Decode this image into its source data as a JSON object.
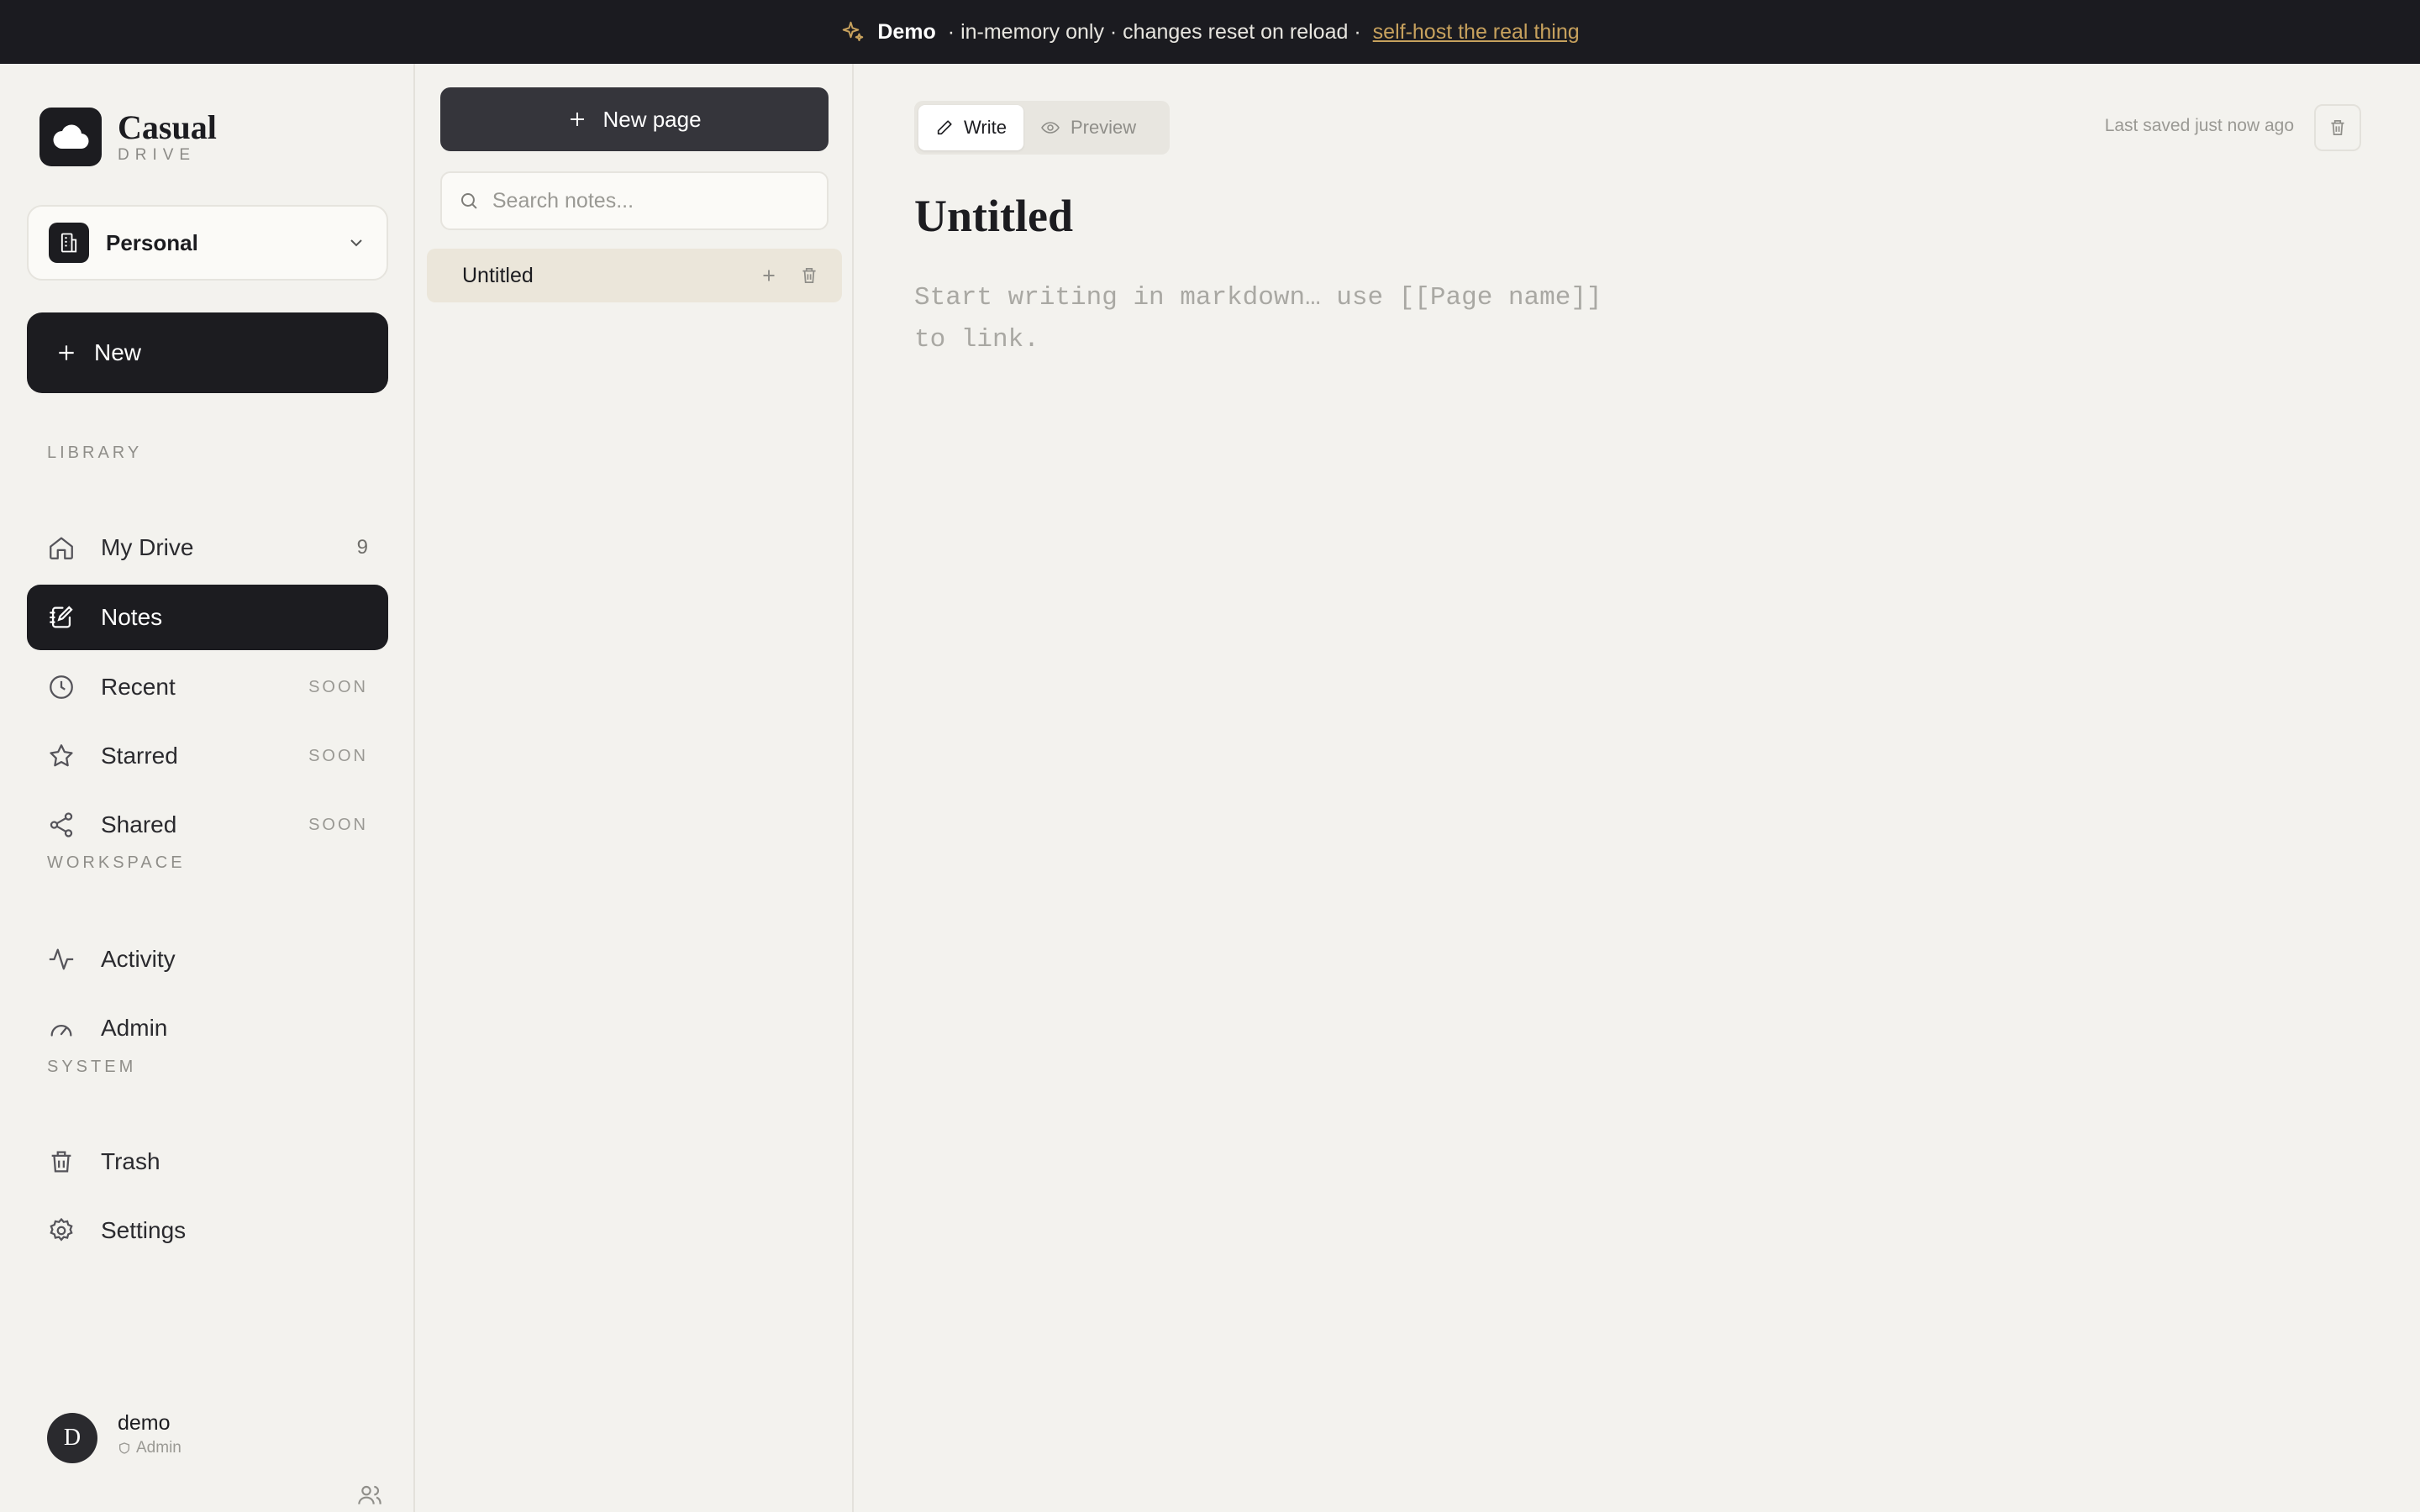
{
  "banner": {
    "strong": "Demo",
    "text": "· in-memory only · changes reset on reload ·",
    "link": "self-host the real thing",
    "accent": "#c7a15d"
  },
  "brand": {
    "name": "Casual",
    "sub": "DRIVE"
  },
  "workspace": {
    "label": "Personal",
    "icon": "building-icon"
  },
  "sidebar": {
    "new_label": "New",
    "sections": {
      "library": "LIBRARY",
      "workspace": "WORKSPACE",
      "system": "SYSTEM"
    },
    "items": [
      {
        "label": "My Drive",
        "icon": "home-icon",
        "meta": "9"
      },
      {
        "label": "Notes",
        "icon": "notes-icon",
        "meta": "",
        "active": true
      },
      {
        "label": "Recent",
        "icon": "clock-icon",
        "meta": "SOON"
      },
      {
        "label": "Starred",
        "icon": "star-icon",
        "meta": "SOON"
      },
      {
        "label": "Shared",
        "icon": "share-icon",
        "meta": "SOON"
      },
      {
        "label": "Activity",
        "icon": "activity-icon",
        "meta": ""
      },
      {
        "label": "Admin",
        "icon": "gauge-icon",
        "meta": ""
      },
      {
        "label": "Trash",
        "icon": "trash-icon",
        "meta": ""
      },
      {
        "label": "Settings",
        "icon": "gear-icon",
        "meta": ""
      }
    ]
  },
  "user": {
    "initial": "D",
    "name": "demo",
    "role": "Admin"
  },
  "notes": {
    "new_page_label": "New page",
    "search_placeholder": "Search notes...",
    "items": [
      {
        "title": "Untitled"
      }
    ]
  },
  "editor": {
    "tab_write": "Write",
    "tab_preview": "Preview",
    "active_tab": "Write",
    "saved": "Last saved just now ago",
    "title": "Untitled",
    "body_placeholder": "Start writing in markdown… use [[Page name]]\nto link."
  },
  "colors": {
    "background": "#f3f2ee",
    "dark": "#1c1c20",
    "banner": "#1b1b20",
    "selected_note": "#ebe6da"
  }
}
